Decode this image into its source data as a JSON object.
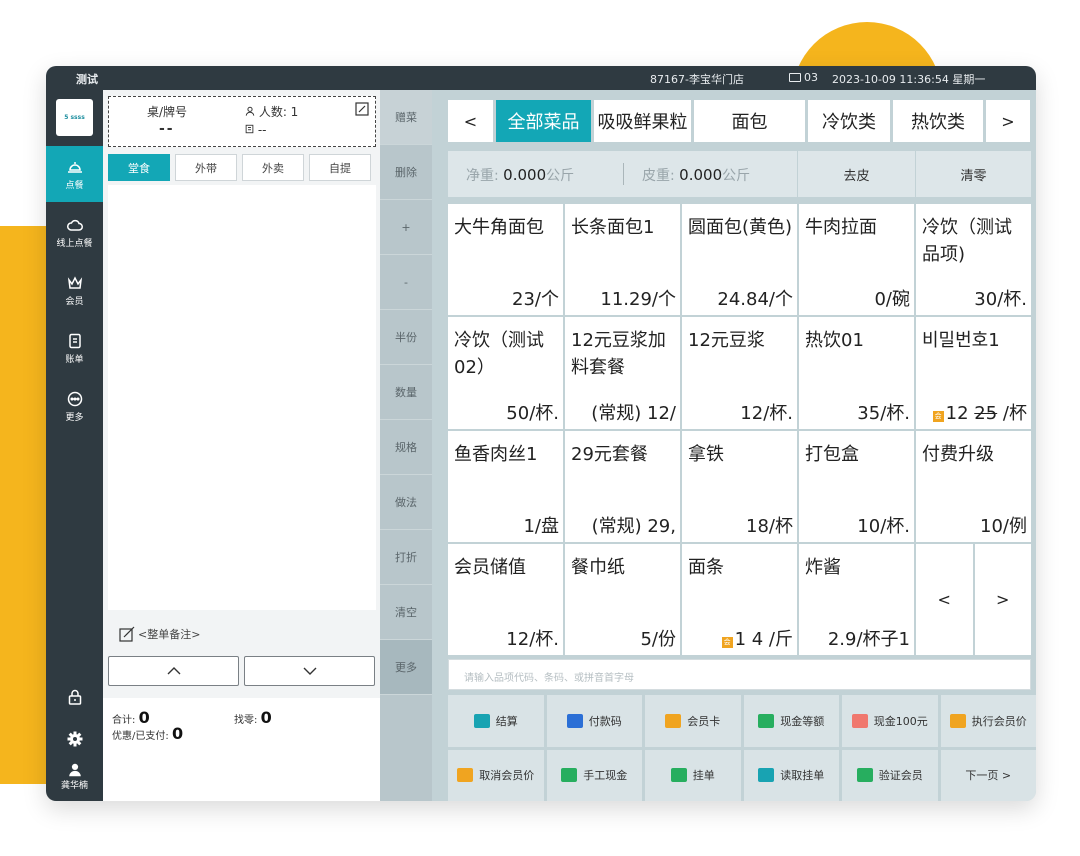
{
  "titlebar": {
    "app_title": "测试",
    "store": "87167-李宝华门店",
    "terminal": "03",
    "datetime": "2023-10-09 11:36:54 星期一"
  },
  "sidebar": {
    "logo_text": "5 ssss",
    "items": [
      {
        "label": "点餐",
        "icon": "bell-icon"
      },
      {
        "label": "线上点餐",
        "icon": "cloud-icon"
      },
      {
        "label": "会员",
        "icon": "crown-icon"
      },
      {
        "label": "账单",
        "icon": "bill-icon"
      },
      {
        "label": "更多",
        "icon": "more-icon"
      }
    ],
    "user_name": "龚华楠"
  },
  "order": {
    "table_label": "桌/牌号",
    "table_number": "--",
    "guests_label": "人数: 1",
    "waiter_value": "--",
    "tabs": [
      "堂食",
      "外带",
      "外卖",
      "自提"
    ],
    "remarks": "<整单备注>",
    "total_label": "合计:",
    "total_value": "0",
    "paid_label": "优惠/已支付:",
    "paid_value": "0",
    "change_label": "找零:",
    "change_value": "0"
  },
  "actions": [
    "赠菜",
    "删除",
    "+",
    "-",
    "半份",
    "数量",
    "规格",
    "做法",
    "打折",
    "清空",
    "更多"
  ],
  "categories": {
    "prev": "<",
    "tabs": [
      "全部菜品",
      "吸吸鲜果粒",
      "面包",
      "冷饮类",
      "热饮类"
    ],
    "next": ">"
  },
  "scale": {
    "net_label": "净重:",
    "net_value": "0.000",
    "net_unit": "公斤",
    "tare_label": "皮重:",
    "tare_value": "0.000",
    "tare_unit": "公斤",
    "tare_button": "去皮",
    "zero_button": "清零"
  },
  "products": [
    {
      "name": "大牛角面包",
      "price": "23/个"
    },
    {
      "name": "长条面包1",
      "price": "11.29/个"
    },
    {
      "name": "圆面包(黄色)",
      "price": "24.84/个"
    },
    {
      "name": "牛肉拉面",
      "price": "0/碗"
    },
    {
      "name": "冷饮（测试品项)",
      "price": "30/杯."
    },
    {
      "name": "冷饮（测试02）",
      "price": "50/杯."
    },
    {
      "name": "12元豆浆加料套餐",
      "price": "(常规) 12/"
    },
    {
      "name": "12元豆浆",
      "price": "12/杯."
    },
    {
      "name": "热饮01",
      "price": "35/杯."
    },
    {
      "name": "비밀번호1",
      "price": "12",
      "old_price": "25",
      "unit": "/杯"
    },
    {
      "name": "鱼香肉丝1",
      "price": "1/盘"
    },
    {
      "name": "29元套餐",
      "price": "(常规) 29,"
    },
    {
      "name": "拿铁",
      "price": "18/杯"
    },
    {
      "name": "打包盒",
      "price": "10/杯."
    },
    {
      "name": "付费升级",
      "price": "10/例"
    },
    {
      "name": "会员储值",
      "price": "12/杯."
    },
    {
      "name": "餐巾纸",
      "price": "5/份"
    },
    {
      "name": "面条",
      "price": "1 4 /斤"
    },
    {
      "name": "炸酱",
      "price": "2.9/杯子1"
    }
  ],
  "pager": {
    "prev": "<",
    "next": ">"
  },
  "search": {
    "placeholder": "请输入品项代码、条码、或拼音首字母"
  },
  "ops": [
    {
      "label": "结算",
      "icon": "teal"
    },
    {
      "label": "付款码",
      "icon": "blue"
    },
    {
      "label": "会员卡",
      "icon": "orange"
    },
    {
      "label": "现金等额",
      "icon": "green"
    },
    {
      "label": "现金100元",
      "icon": "red"
    },
    {
      "label": "执行会员价",
      "icon": "orange"
    },
    {
      "label": "取消会员价",
      "icon": "orange"
    },
    {
      "label": "手工现金",
      "icon": "green"
    },
    {
      "label": "挂单",
      "icon": "green"
    },
    {
      "label": "读取挂单",
      "icon": "teal"
    },
    {
      "label": "验证会员",
      "icon": "green"
    },
    {
      "label": "下一页 >",
      "icon": ""
    }
  ],
  "colors": {
    "accent": "#13a7b6",
    "sidebar": "#2f3a41",
    "background_deco": "#f5b51d"
  }
}
